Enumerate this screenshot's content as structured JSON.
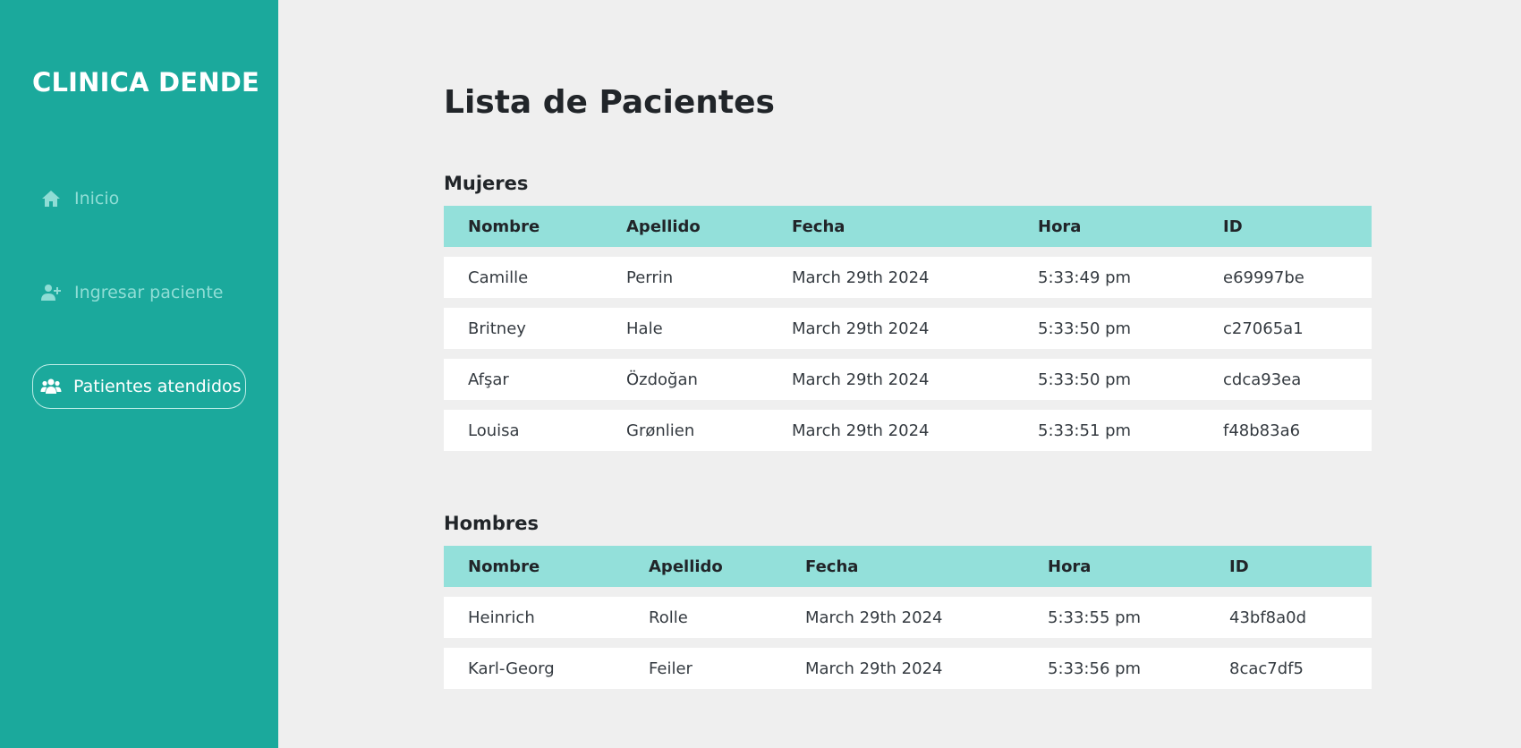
{
  "sidebar": {
    "brand": "CLINICA DENDE",
    "items": [
      {
        "label": "Inicio",
        "icon": "home-icon"
      },
      {
        "label": "Ingresar paciente",
        "icon": "user-plus-icon"
      },
      {
        "label": "Patientes atendidos",
        "icon": "users-icon",
        "active": true
      }
    ]
  },
  "main": {
    "title": "Lista de Pacientes",
    "sections": [
      {
        "title": "Mujeres",
        "columns": [
          "Nombre",
          "Apellido",
          "Fecha",
          "Hora",
          "ID"
        ],
        "rows": [
          [
            "Camille",
            "Perrin",
            "March 29th 2024",
            "5:33:49 pm",
            "e69997be"
          ],
          [
            "Britney",
            "Hale",
            "March 29th 2024",
            "5:33:50 pm",
            "c27065a1"
          ],
          [
            "Afşar",
            "Özdoğan",
            "March 29th 2024",
            "5:33:50 pm",
            "cdca93ea"
          ],
          [
            "Louisa",
            "Grønlien",
            "March 29th 2024",
            "5:33:51 pm",
            "f48b83a6"
          ]
        ]
      },
      {
        "title": "Hombres",
        "columns": [
          "Nombre",
          "Apellido",
          "Fecha",
          "Hora",
          "ID"
        ],
        "rows": [
          [
            "Heinrich",
            "Rolle",
            "March 29th 2024",
            "5:33:55 pm",
            "43bf8a0d"
          ],
          [
            "Karl-Georg",
            "Feiler",
            "March 29th 2024",
            "5:33:56 pm",
            "8cac7df5"
          ]
        ]
      }
    ]
  },
  "colors": {
    "sidebar": "#1ba99c",
    "table_header": "#93e0da",
    "background": "#efefef"
  }
}
